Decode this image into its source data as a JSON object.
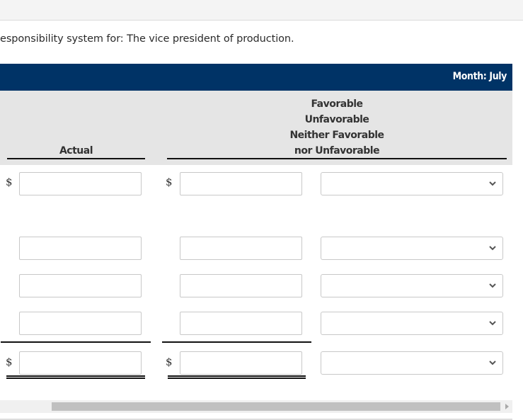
{
  "prompt": "esponsibility system for: The vice president of production.",
  "header": {
    "month_label": "Month: July",
    "bar_color": "#003366"
  },
  "columns": {
    "actual": "Actual",
    "status_lines": [
      "Favorable",
      "Unfavorable",
      "Neither Favorable",
      "nor Unfavorable"
    ]
  },
  "currency_symbol": "$",
  "rows": [
    {
      "actual": "",
      "budget": "",
      "status": "",
      "show_dollar": true
    },
    {
      "actual": "",
      "budget": "",
      "status": "",
      "show_dollar": false
    },
    {
      "actual": "",
      "budget": "",
      "status": "",
      "show_dollar": false
    },
    {
      "actual": "",
      "budget": "",
      "status": "",
      "show_dollar": false
    },
    {
      "actual": "",
      "budget": "",
      "status": "",
      "show_dollar": true,
      "total": true
    }
  ]
}
